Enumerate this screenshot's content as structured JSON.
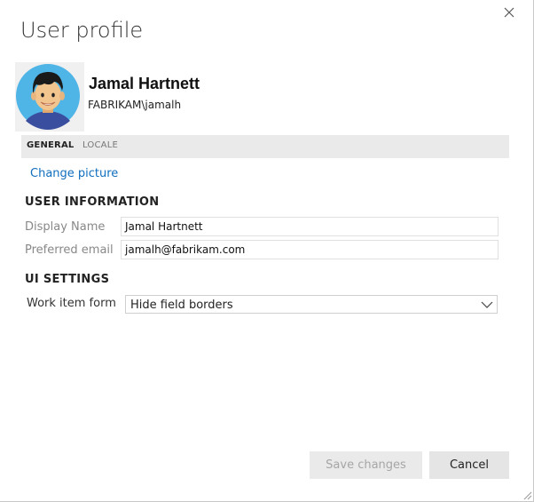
{
  "dialog": {
    "title": "User profile",
    "close_icon": "close-icon"
  },
  "profile": {
    "display_name": "Jamal Hartnett",
    "account": "FABRIKAM\\jamalh",
    "avatar_icon": "avatar"
  },
  "tabs": [
    {
      "label": "GENERAL",
      "selected": true
    },
    {
      "label": "LOCALE",
      "selected": false
    }
  ],
  "change_picture_label": "Change picture",
  "user_information": {
    "heading": "USER INFORMATION",
    "display_name_label": "Display Name",
    "display_name_value": "Jamal Hartnett",
    "email_label": "Preferred email",
    "email_value": "jamalh@fabrikam.com"
  },
  "ui_settings": {
    "heading": "UI SETTINGS",
    "work_item_form_label": "Work item form",
    "work_item_form_value": "Hide field borders"
  },
  "buttons": {
    "save_label": "Save changes",
    "save_enabled": false,
    "cancel_label": "Cancel"
  },
  "colors": {
    "link": "#106ebe",
    "tabbar_bg": "#eaeaea",
    "avatar_bg": "#4fb4e6"
  }
}
